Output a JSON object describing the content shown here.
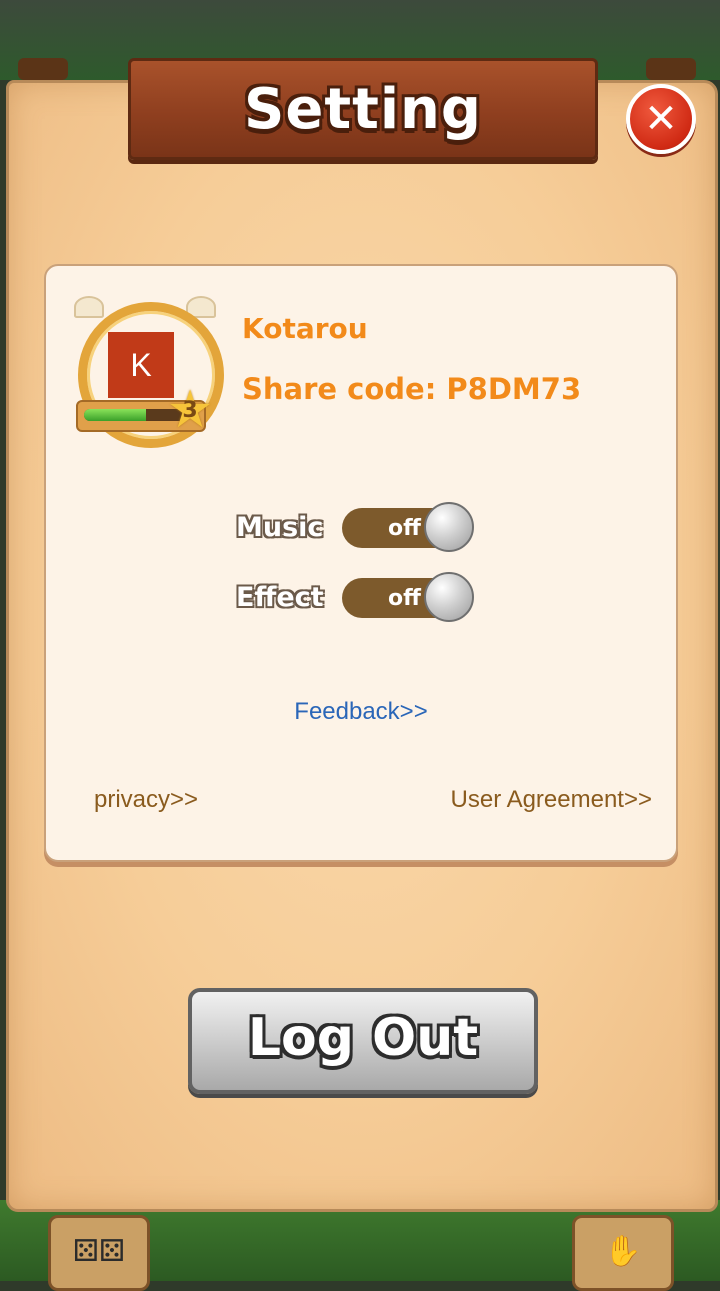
{
  "dialog": {
    "title": "Setting",
    "close_icon": "close-x-icon"
  },
  "profile": {
    "avatar_letter": "K",
    "avatar_color": "#c13a18",
    "username": "Kotarou",
    "share_code": "Share code: P8DM73",
    "level": "3",
    "xp_progress": 0.6
  },
  "settings": {
    "music_label": "Music",
    "music_state": "off",
    "effect_label": "Effect",
    "effect_state": "off"
  },
  "links": {
    "feedback": "Feedback>>",
    "privacy": "privacy>>",
    "user_agreement": "User Agreement>>"
  },
  "actions": {
    "logout_label": "Log Out"
  },
  "colors": {
    "accent": "#f28a1a",
    "link_blue": "#2a66b8",
    "link_brown": "#8a5b1e",
    "close_red": "#d02a14"
  }
}
